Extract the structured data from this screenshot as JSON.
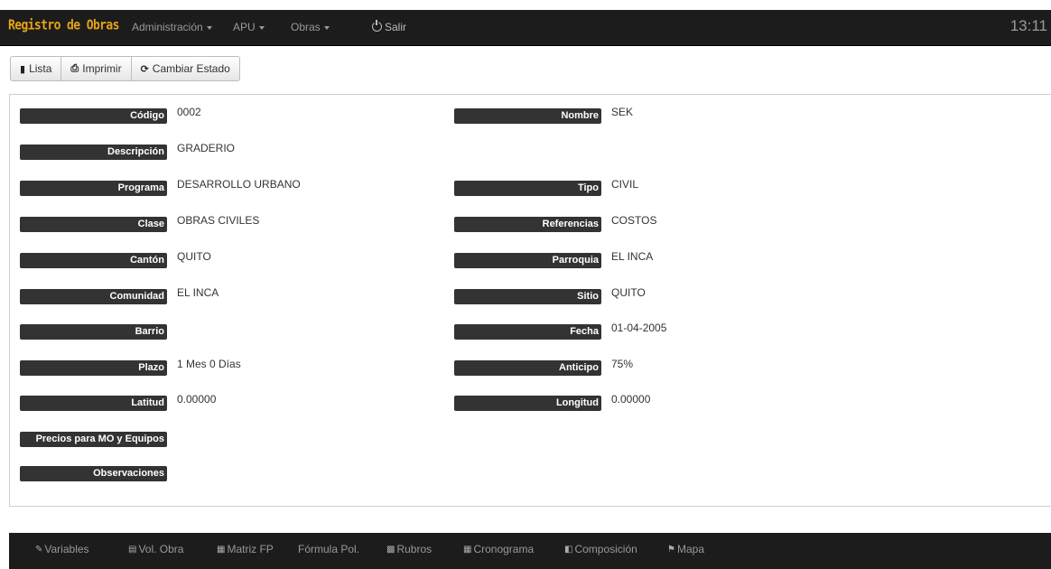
{
  "navbar": {
    "brand": "Registro de Obras",
    "menu": [
      {
        "label": "Administración",
        "dropdown": true
      },
      {
        "label": "APU",
        "dropdown": true
      },
      {
        "label": "Obras",
        "dropdown": true
      }
    ],
    "logout_label": "Salir",
    "clock": "13:11"
  },
  "toolbar": {
    "lista": "Lista",
    "imprimir": "Imprimir",
    "cambiar_estado": "Cambiar Estado"
  },
  "fields": {
    "codigo": {
      "label": "Código",
      "value": "0002"
    },
    "nombre": {
      "label": "Nombre",
      "value": "SEK"
    },
    "descripcion": {
      "label": "Descripción",
      "value": "GRADERIO"
    },
    "programa": {
      "label": "Programa",
      "value": "DESARROLLO URBANO"
    },
    "tipo": {
      "label": "Tipo",
      "value": "CIVIL"
    },
    "clase": {
      "label": "Clase",
      "value": "OBRAS CIVILES"
    },
    "referencias": {
      "label": "Referencias",
      "value": "COSTOS"
    },
    "canton": {
      "label": "Cantón",
      "value": "QUITO"
    },
    "parroquia": {
      "label": "Parroquia",
      "value": "EL INCA"
    },
    "comunidad": {
      "label": "Comunidad",
      "value": "EL INCA"
    },
    "sitio": {
      "label": "Sitio",
      "value": "QUITO"
    },
    "barrio": {
      "label": "Barrio",
      "value": ""
    },
    "fecha": {
      "label": "Fecha",
      "value": "01-04-2005"
    },
    "plazo": {
      "label": "Plazo",
      "value": "1 Mes 0 Días"
    },
    "anticipo": {
      "label": "Anticipo",
      "value": "75%"
    },
    "latitud": {
      "label": "Latitud",
      "value": "0.00000"
    },
    "longitud": {
      "label": "Longitud",
      "value": "0.00000"
    },
    "precios": {
      "label": "Precios para MO y Equipos",
      "value": ""
    },
    "observaciones": {
      "label": "Observaciones",
      "value": ""
    }
  },
  "bottom_tabs": {
    "variables": "Variables",
    "vol_obra": "Vol. Obra",
    "matriz_fp": "Matriz FP",
    "formula_pol": "Fórmula Pol.",
    "rubros": "Rubros",
    "cronograma": "Cronograma",
    "composicion": "Composición",
    "mapa": "Mapa"
  }
}
